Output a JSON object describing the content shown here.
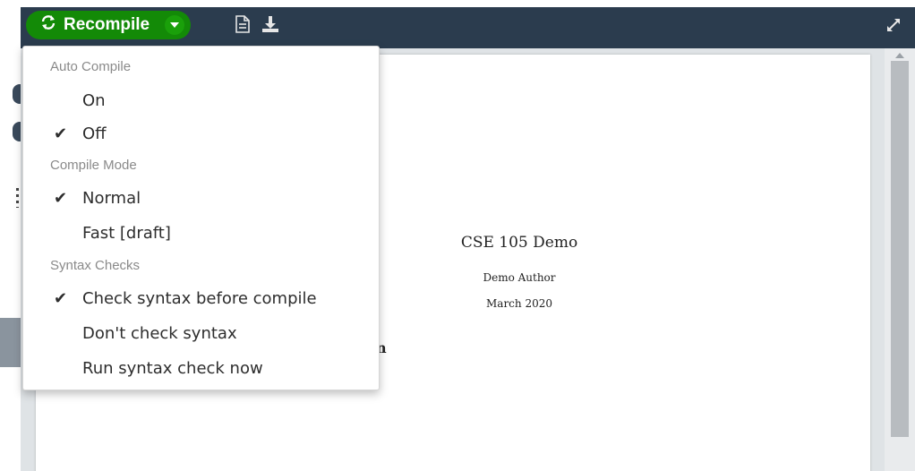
{
  "toolbar": {
    "recompile_label": "Recompile",
    "icons": {
      "refresh": "refresh-icon",
      "caret": "caret-down-icon",
      "logs": "document-icon",
      "download": "download-icon",
      "expand": "expand-icon"
    }
  },
  "pdf": {
    "title": "CSE 105 Demo",
    "author": "Demo Author",
    "date": "March 2020",
    "fragment": "n"
  },
  "menu": {
    "auto_compile_header": "Auto Compile",
    "auto_on": "On",
    "auto_off": "Off",
    "compile_mode_header": "Compile Mode",
    "mode_normal": "Normal",
    "mode_fast": "Fast [draft]",
    "syntax_header": "Syntax Checks",
    "syntax_check": "Check syntax before compile",
    "syntax_dont": "Don't check syntax",
    "syntax_run": "Run syntax check now",
    "checkmark": "✔"
  },
  "colors": {
    "toolbar_bg": "#2b3c4e",
    "recompile_green": "#138a07",
    "menu_header_gray": "#8a8a8a"
  }
}
